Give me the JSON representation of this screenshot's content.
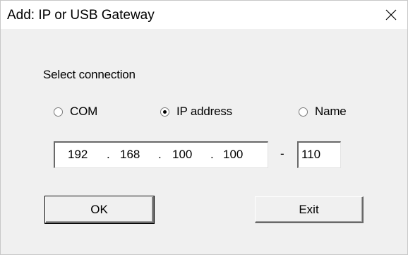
{
  "window": {
    "title": "Add: IP or USB Gateway"
  },
  "icons": {
    "close": "close-icon"
  },
  "connection": {
    "label": "Select connection",
    "options": [
      {
        "label": "COM",
        "selected": false
      },
      {
        "label": "IP address",
        "selected": true
      },
      {
        "label": "Name",
        "selected": false
      }
    ]
  },
  "ip": {
    "octets": [
      "192",
      "168",
      "100",
      "100"
    ],
    "separator": ".",
    "range_dash": "-",
    "range_end": "110"
  },
  "buttons": {
    "ok": "OK",
    "exit": "Exit"
  }
}
